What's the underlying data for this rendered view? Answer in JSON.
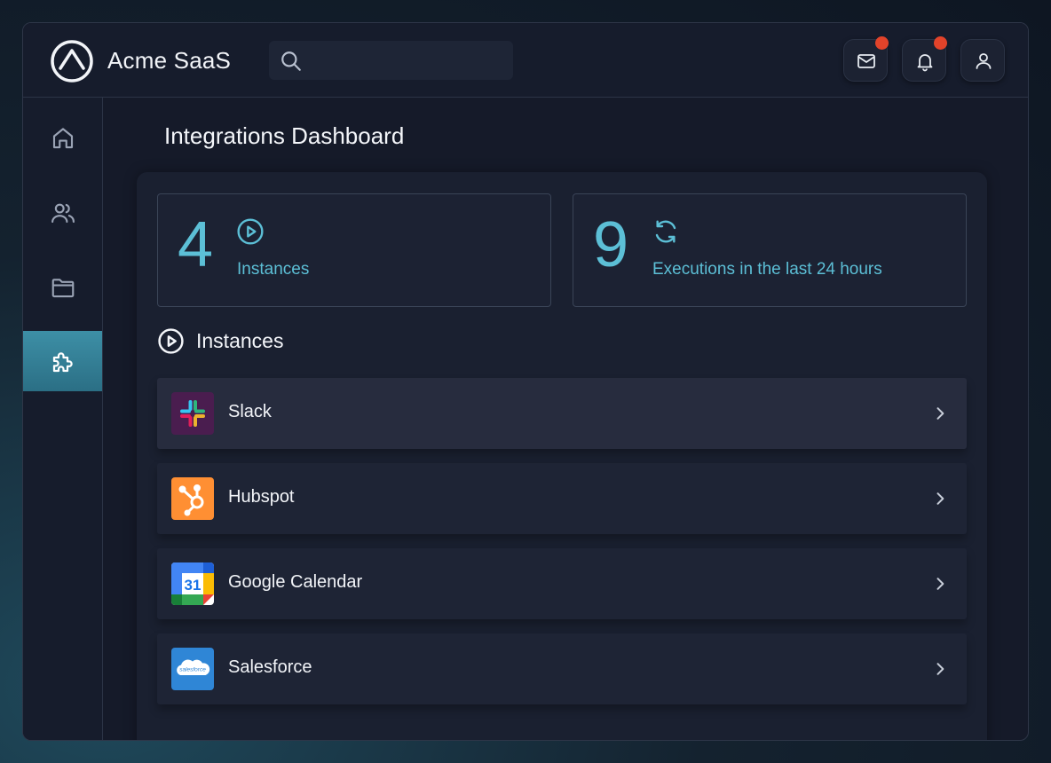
{
  "app": {
    "name": "Acme SaaS"
  },
  "search": {
    "placeholder": ""
  },
  "header_icons": [
    {
      "icon": "mail-icon",
      "badge": true
    },
    {
      "icon": "bell-icon",
      "badge": true
    },
    {
      "icon": "user-icon",
      "badge": false
    }
  ],
  "sidebar": {
    "items": [
      {
        "icon": "home-icon",
        "active": false
      },
      {
        "icon": "users-icon",
        "active": false
      },
      {
        "icon": "folder-icon",
        "active": false
      },
      {
        "icon": "puzzle-icon",
        "active": true
      }
    ]
  },
  "page": {
    "title": "Integrations Dashboard"
  },
  "stats": [
    {
      "value": "4",
      "label": "Instances",
      "icon": "play-circle-icon"
    },
    {
      "value": "9",
      "label": "Executions in the last 24 hours",
      "icon": "refresh-icon"
    }
  ],
  "instances_section": {
    "title": "Instances"
  },
  "instances": [
    {
      "name": "Slack",
      "logo": "slack-logo"
    },
    {
      "name": "Hubspot",
      "logo": "hubspot-logo"
    },
    {
      "name": "Google Calendar",
      "logo": "google-calendar-logo",
      "logo_text": "31"
    },
    {
      "name": "Salesforce",
      "logo": "salesforce-logo",
      "logo_text": "salesforce"
    }
  ],
  "colors": {
    "accent": "#5cbfd6",
    "badge": "#e2432a",
    "active_nav": "#3d8fa6"
  }
}
